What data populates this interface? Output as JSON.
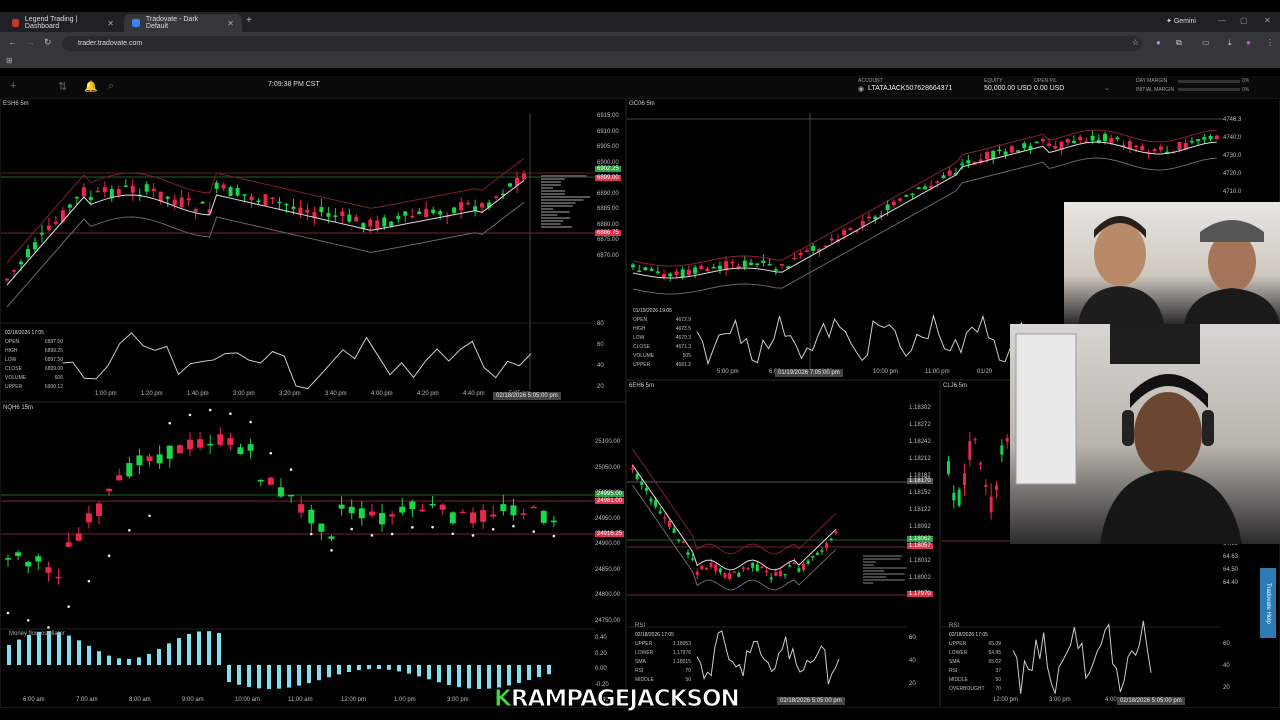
{
  "browser": {
    "tabs": [
      {
        "title": "Legend Trading | Dashboard",
        "fav_color": "#c0392b"
      },
      {
        "title": "Tradovate - Dark Default",
        "fav_color": "#3a82f7"
      }
    ],
    "gemini_label": "Gemini",
    "url": "trader.tradovate.com"
  },
  "toolbar": {
    "clock": "7:09:38 PM CST"
  },
  "account": {
    "account_label": "ACCOUNT",
    "account_id": "LTATAJACK507628664371",
    "equity_label": "EQUITY",
    "equity_value": "50,000.00 USD",
    "openpl_label": "OPEN P/L",
    "openpl_value": "0.00 USD",
    "day_margin_label": "DAY MARGIN",
    "day_margin_pct": "0%",
    "initial_margin_label": "INITIAL MARGIN",
    "initial_margin_pct": "0%"
  },
  "charts": {
    "es": {
      "title": "ESH6 5m",
      "price_ticks": [
        "6915.00",
        "6910.00",
        "6905.00",
        "6900.00",
        "6895.00",
        "6890.00",
        "6885.00",
        "6880.00",
        "6875.00",
        "6870.00"
      ],
      "tag_green": "6902.25",
      "tag_red1": "6899.00",
      "tag_red2": "6886.75",
      "time_ticks": [
        "1:00 pm",
        "1:20 pm",
        "1:40 pm",
        "3:00 pm",
        "3:20 pm",
        "3:40 pm",
        "4:00 pm",
        "4:20 pm",
        "4:40 pm",
        "5:25 pm"
      ],
      "cursor_time": "02/18/2026 5:05:00 pm",
      "osc_ticks": [
        "80",
        "60",
        "40",
        "20"
      ],
      "ohlc": {
        "date": "02/18/2026 17:05",
        "open": "6897.50",
        "high": "6899.25",
        "low": "6897.50",
        "close": "6899.00",
        "volume": "606",
        "upper": "6900.12"
      }
    },
    "gc": {
      "title": "GC06 5m",
      "price_ticks": [
        "4746.3",
        "4740.0",
        "4730.0",
        "4720.0",
        "4710.0"
      ],
      "time_ticks": [
        "5:00 pm",
        "6:00 pm",
        "9:00 pm",
        "10:00 pm",
        "11:00 pm",
        "01/20"
      ],
      "cursor_time": "01/19/2026 7:05:00 pm",
      "ohlc": {
        "date": "01/19/2026 19:05",
        "open": "4672.9",
        "high": "4673.5",
        "low": "4670.3",
        "close": "4671.3",
        "volume": "505",
        "upper": "4681.2"
      }
    },
    "nq": {
      "title": "NQH6 15m",
      "price_ticks": [
        "25100.00",
        "25050.00",
        "25000.00",
        "24950.00",
        "24900.00",
        "24850.00",
        "24800.00",
        "24750.00"
      ],
      "tag_green": "24995.00",
      "tag_red1": "24981.00",
      "tag_red2": "24916.25",
      "osc_label": "Money flow oscillator",
      "osc_ticks": [
        "0.40",
        "0.20",
        "0.00",
        "-0.20",
        "-0.40"
      ],
      "time_ticks": [
        "6:00 am",
        "7:00 am",
        "8:00 am",
        "9:00 am",
        "10:00 am",
        "11:00 am",
        "12:00 pm",
        "1:00 pm",
        "3:00 pm"
      ]
    },
    "eh": {
      "title": "6EH6 5m",
      "price_ticks": [
        "1.18302",
        "1.18272",
        "1.18242",
        "1.18212",
        "1.18182",
        "1.18152",
        "1.18122",
        "1.18092",
        "1.18062",
        "1.18032",
        "1.18002",
        "1.17972"
      ],
      "tag_green": "1.18062",
      "tag_red1": "1.18057",
      "tag_red2": "1.17970",
      "tag_gray": "1.18170",
      "osc_label": "RSI",
      "osc_ticks": [
        "60",
        "40",
        "20"
      ],
      "cursor_time": "02/18/2026 5:05:00 pm",
      "ohlc": {
        "date": "02/18/2026 17:05",
        "upper": "1.18053",
        "lower": "1.17976",
        "sma": "1.18015",
        "rsi": "70",
        "middle": "50"
      }
    },
    "cl": {
      "title": "CLJ6 5m",
      "price_ticks": [
        "64.69",
        "64.63",
        "64.50",
        "64.40"
      ],
      "osc_label": "RSI",
      "osc_ticks": [
        "60",
        "40",
        "20"
      ],
      "time_ticks": [
        "12:00 pm",
        "3:00 pm",
        "4:00"
      ],
      "cursor_time": "02/18/2026 5:05:00 pm",
      "ohlc": {
        "date": "02/18/2026 17:05",
        "upper": "65.09",
        "lower": "64.95",
        "sma": "65.02",
        "rsi": "37",
        "middle": "50",
        "over": "70"
      }
    }
  },
  "help_tab": "Tradovate Help",
  "caption": {
    "k": "K",
    "rest": "RAMPAGEJACKSON"
  }
}
